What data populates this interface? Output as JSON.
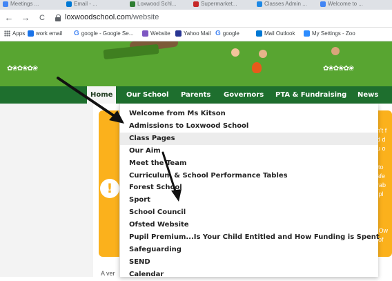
{
  "browser": {
    "tabs": [
      {
        "label": "Meetings ...",
        "icon": "mail-icon",
        "color": "#4285f4"
      },
      {
        "label": "Email - ...",
        "icon": "outlook-icon",
        "color": "#0078d4"
      },
      {
        "label": "Loxwood Schl...",
        "icon": "school-icon",
        "color": "#2e7d32"
      },
      {
        "label": "Supermarket...",
        "icon": "store-icon",
        "color": "#c62828"
      },
      {
        "label": "Classes Admin ...",
        "icon": "blue-icon",
        "color": "#1e88e5"
      },
      {
        "label": "Welcome to ...",
        "icon": "pen-icon",
        "color": "#4285f4"
      }
    ],
    "nav": {
      "back": "←",
      "forward": "→",
      "reload": "C"
    },
    "url": {
      "domain": "loxwoodschool.com",
      "path": "/website"
    },
    "bookmarks": [
      {
        "label": "Apps",
        "icon": "apps-icon"
      },
      {
        "label": "work email",
        "icon": "email-icon",
        "color": "#1a73e8"
      },
      {
        "label": "google - Google Se...",
        "icon": "google-icon"
      },
      {
        "label": "Website",
        "icon": "website-icon",
        "color": "#7e57c2"
      },
      {
        "label": "Yahoo Mail",
        "icon": "yahoo-mail-icon",
        "color": "#283593"
      },
      {
        "label": "google",
        "icon": "google-icon"
      },
      {
        "label": "Mail Outlook",
        "icon": "outlook-icon",
        "color": "#0078d4"
      },
      {
        "label": "My Settings - Zoo",
        "icon": "zoom-icon",
        "color": "#2d8cff"
      }
    ]
  },
  "site": {
    "colors": {
      "nav": "#1e6f2e",
      "banner": "#58a531",
      "alert": "#fbb11c"
    },
    "nav": [
      "Home",
      "Our School",
      "Parents",
      "Governors",
      "PTA & Fundraising",
      "News"
    ],
    "dropdown": [
      "Welcome from Ms Kitson",
      "Admissions to Loxwood School",
      "Class Pages",
      "Our Aim",
      "Meet the Team",
      "Curriculum & School Performance Tables",
      "Forest School",
      "Sport",
      "School Council",
      "Ofsted Website",
      "Pupil Premium...Is Your Child Entitled and How Funding is Spent",
      "Safeguarding",
      "SEND",
      "Calendar"
    ],
    "side_fragments": [
      "on't f",
      "nd d",
      "ou o",
      "",
      "s to",
      "safe",
      "erab",
      "r, pl",
      "",
      "",
      "",
      "d Ow",
      "s of"
    ],
    "below_text": "A ver",
    "alert_icon": "!"
  }
}
